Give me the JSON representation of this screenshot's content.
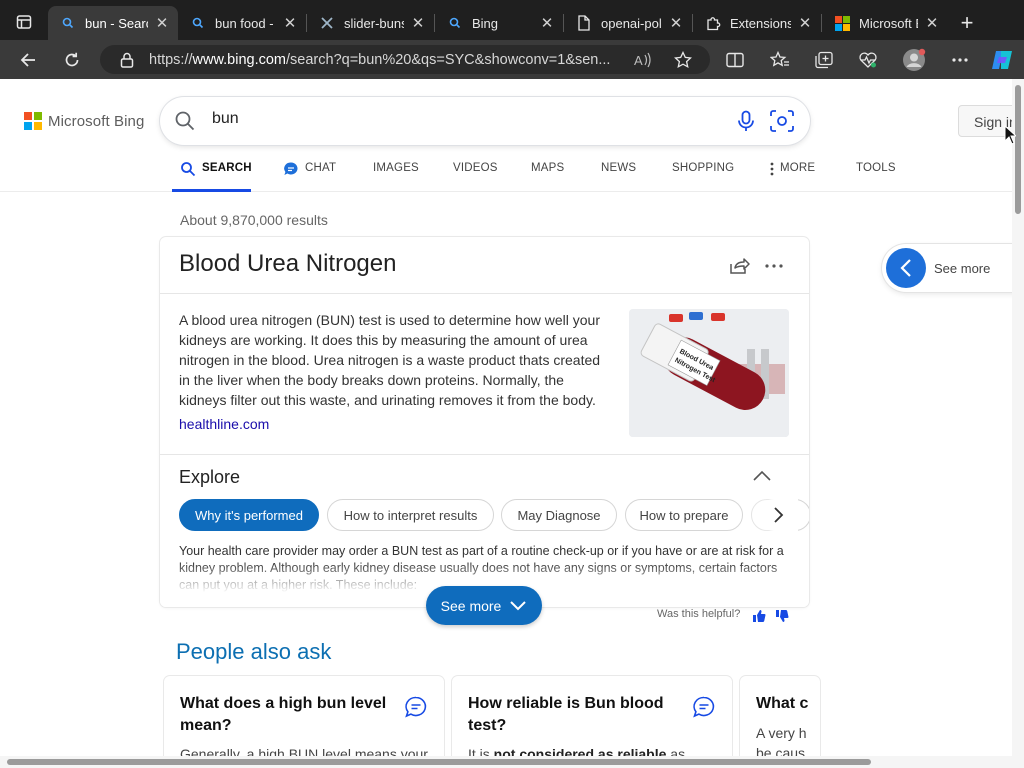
{
  "browser": {
    "tabs": [
      {
        "title": "bun - Search",
        "icon": "search-icon",
        "active": true
      },
      {
        "title": "bun food - Search",
        "icon": "search-icon",
        "active": false
      },
      {
        "title": "slider-buns",
        "icon": "tools-icon",
        "active": false
      },
      {
        "title": "Bing",
        "icon": "search-icon",
        "active": false
      },
      {
        "title": "openai-policy",
        "icon": "document-icon",
        "active": false
      },
      {
        "title": "Extensions",
        "icon": "puzzle-icon",
        "active": false
      },
      {
        "title": "Microsoft Edge",
        "icon": "microsoft-logo-icon",
        "active": false
      }
    ],
    "url_prefix": "https://",
    "url_host": "www.bing.com",
    "url_path": "/search?q=bun%20&qs=SYC&showconv=1&sen..."
  },
  "page": {
    "logo_text": "Microsoft Bing",
    "search_query": "bun",
    "sign_in": "Sign in",
    "nav": {
      "search": "SEARCH",
      "chat": "CHAT",
      "images": "IMAGES",
      "videos": "VIDEOS",
      "maps": "MAPS",
      "news": "NEWS",
      "shopping": "SHOPPING",
      "more": "MORE",
      "tools": "TOOLS"
    },
    "result_count": "About 9,870,000 results",
    "card": {
      "title": "Blood Urea Nitrogen",
      "description": "A blood urea nitrogen (BUN) test is used to determine how well your kidneys are working. It does this by measuring the amount of urea nitrogen in the blood. Urea nitrogen is a waste product thats created in the liver when the body breaks down proteins. Normally, the kidneys filter out this waste, and urinating removes it from the body.",
      "source": "healthline.com",
      "image_label": "Blood Urea Nitrogen Test",
      "explore_title": "Explore",
      "chips": [
        "Why it's performed",
        "How to interpret results",
        "May Diagnose",
        "How to prepare"
      ],
      "explore_text": "Your health care provider may order a BUN test as part of a routine check-up or if you have or are at risk for a kidney problem. Although early kidney disease usually does not have any signs or symptoms, certain factors can put you at a higher risk. These include:"
    },
    "see_more": "See more",
    "side_see_more": "See more",
    "helpful": "Was this helpful?",
    "paa": {
      "title": "People also ask",
      "questions": [
        {
          "q": "What does a high bun level mean?",
          "a": "Generally, a high BUN level means your"
        },
        {
          "q": "How reliable is Bun blood test?",
          "a_bold": "not considered as reliable",
          "a_pre": "It is ",
          "a_post": " as"
        },
        {
          "q": "What c",
          "a": "A very h be caus"
        }
      ]
    }
  },
  "colors": {
    "accent": "#0f6cbd",
    "link": "#1a0dab",
    "paa_title": "#0c6fb2",
    "tab_strip": "#1f1f1f",
    "tab_active": "#3a3a3a"
  }
}
